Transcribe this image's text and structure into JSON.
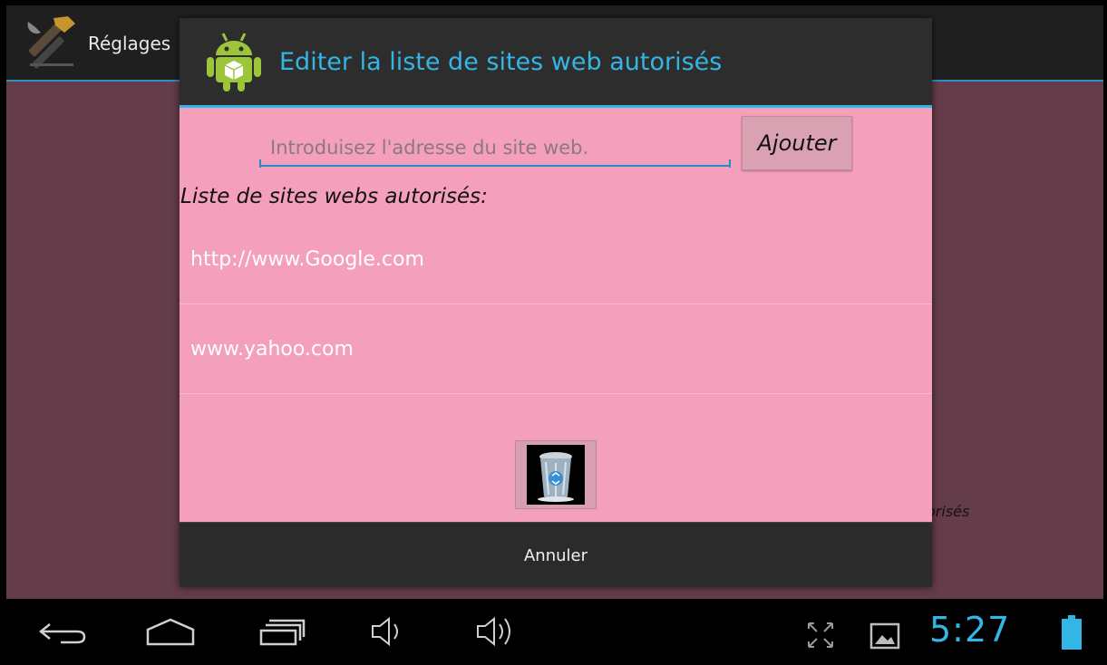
{
  "app": {
    "title": "Réglages",
    "background_text": "orisés"
  },
  "dialog": {
    "title": "Editer la liste de sites web autorisés",
    "input": {
      "placeholder": "Introduisez l'adresse du site web.",
      "value": ""
    },
    "add_label": "Ajouter",
    "list_heading": "Liste de sites webs autorisés:",
    "sites": [
      "http://www.Google.com",
      "www.yahoo.com"
    ],
    "cancel_label": "Annuler"
  },
  "navbar": {
    "clock": "5:27"
  },
  "colors": {
    "accent": "#33b5e5",
    "dialog_bg": "#f49fbb",
    "app_bg": "#643c4a"
  }
}
